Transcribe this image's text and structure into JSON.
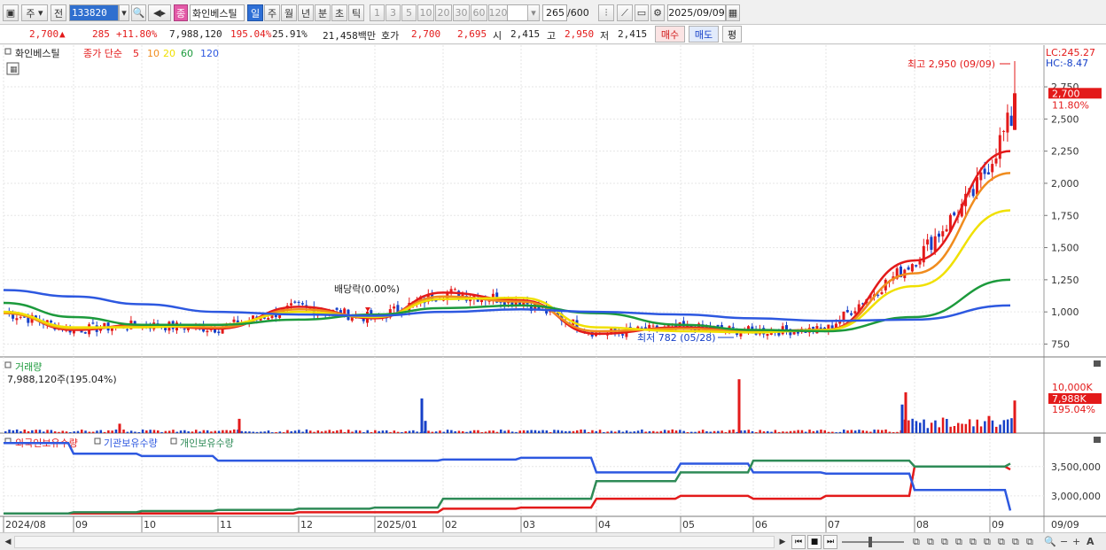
{
  "toolbar": {
    "market_label": "주",
    "prev_label": "전",
    "code": "133820",
    "sort_label": "종",
    "stock_name": "화인베스틸",
    "period_tabs": [
      "일",
      "주",
      "월",
      "년",
      "분",
      "초",
      "틱"
    ],
    "active_period": "일",
    "intervals": [
      "1",
      "3",
      "5",
      "10",
      "20",
      "30",
      "60",
      "120"
    ],
    "count": "265",
    "count_total": "/600",
    "date": "2025/09/09"
  },
  "quote": {
    "price": "2,700",
    "change": "285",
    "change_pct": "+11.80%",
    "volume": "7,988,120",
    "volume_ratio": "195.04%",
    "turnover": "25.91%",
    "amount": "21,458백만",
    "hoga_label": "호가",
    "ask": "2,700",
    "bid": "2,695",
    "open_label": "시",
    "open": "2,415",
    "high_label": "고",
    "high": "2,950",
    "low_label": "저",
    "low": "2,415",
    "buy_label": "매수",
    "sell_label": "매도",
    "eval_label": "평"
  },
  "price_panel": {
    "stock_label": "화인베스틸",
    "ma_title": "종가 단순",
    "ma_periods": [
      "5",
      "10",
      "20",
      "60",
      "120"
    ],
    "lc": "LC:245.27",
    "hc": "HC:-8.47",
    "current_tag": "2,700",
    "current_pct": "11.80%",
    "high_annot": "최고 2,950 (09/09)",
    "low_annot": "최저 782 (05/28)",
    "dividend_annot": "배당락(0.00%)",
    "y_ticks": [
      "750",
      "1,000",
      "1,250",
      "1,500",
      "1,750",
      "2,000",
      "2,250",
      "2,500",
      "2,750"
    ]
  },
  "volume_panel": {
    "title": "거래량",
    "value": "7,988,120주(195.04%)",
    "tag_top": "10,000K",
    "tag_value": "7,988K",
    "tag_pct": "195.04%"
  },
  "holding_panel": {
    "labels": [
      "외국인보유수량",
      "기관보유수량",
      "개인보유수량"
    ],
    "y_ticks": [
      "3,500,000",
      "3,000,000"
    ]
  },
  "x_axis": [
    "2024/08",
    "09",
    "10",
    "11",
    "12",
    "2025/01",
    "02",
    "03",
    "04",
    "05",
    "06",
    "07",
    "08",
    "09",
    "09/09"
  ],
  "colors": {
    "up": "#e31a1a",
    "down": "#1640c8",
    "ma5": "#e31a1a",
    "ma10": "#f08c1e",
    "ma20": "#f0e000",
    "ma60": "#1c9a3c",
    "ma120": "#2d58e0",
    "foreign": "#e31a1a",
    "institution": "#2d58e0",
    "individual": "#2e8b57"
  },
  "chart_data": [
    {
      "type": "line",
      "title": "화인베스틸",
      "description": "Daily price with moving averages",
      "x": [
        "2024/08",
        "09",
        "10",
        "11",
        "12",
        "2025/01",
        "02",
        "03",
        "04",
        "05",
        "06",
        "07",
        "08",
        "09"
      ],
      "series": [
        {
          "name": "5",
          "values": [
            1000,
            860,
            900,
            870,
            1040,
            950,
            1150,
            1090,
            830,
            880,
            850,
            860,
            1400,
            2250
          ]
        },
        {
          "name": "10",
          "values": [
            990,
            870,
            890,
            880,
            1020,
            960,
            1120,
            1080,
            850,
            870,
            850,
            860,
            1300,
            2080
          ]
        },
        {
          "name": "20",
          "values": [
            1000,
            880,
            880,
            900,
            1000,
            960,
            1100,
            1110,
            880,
            850,
            840,
            860,
            1200,
            1790
          ]
        },
        {
          "name": "60",
          "values": [
            1070,
            960,
            900,
            900,
            940,
            980,
            1030,
            1050,
            990,
            900,
            860,
            850,
            960,
            1250
          ]
        },
        {
          "name": "120",
          "values": [
            1170,
            1120,
            1060,
            1000,
            980,
            970,
            1000,
            1020,
            1000,
            980,
            950,
            930,
            940,
            1050
          ]
        }
      ],
      "ylim": [
        650,
        2950
      ],
      "high": 2950,
      "low": 782
    },
    {
      "type": "bar",
      "title": "거래량",
      "categories": [
        "2024/08",
        "09",
        "10",
        "11",
        "12",
        "2025/01",
        "02",
        "03",
        "04",
        "05",
        "06",
        "07",
        "08",
        "09"
      ],
      "values": [
        1500,
        800,
        2500,
        600,
        4000,
        900,
        11000,
        1200,
        600,
        700,
        16000,
        900,
        13500,
        7988
      ],
      "ylabel": "K"
    },
    {
      "type": "line",
      "title": "보유수량",
      "x": [
        "2024/08",
        "09",
        "10",
        "11",
        "12",
        "2025/01",
        "02",
        "03",
        "04",
        "05",
        "06",
        "07",
        "08",
        "09"
      ],
      "series": [
        {
          "name": "외국인보유수량",
          "values": [
            2700000,
            2700000,
            2700000,
            2700000,
            2720000,
            2720000,
            2780000,
            2800000,
            2950000,
            3000000,
            2950000,
            3000000,
            3500000,
            3450000
          ]
        },
        {
          "name": "기관보유수량",
          "values": [
            3900000,
            3720000,
            3680000,
            3600000,
            3600000,
            3600000,
            3620000,
            3650000,
            3400000,
            3550000,
            3400000,
            3380000,
            3100000,
            2750000
          ]
        },
        {
          "name": "개인보유수량",
          "values": [
            2700000,
            2720000,
            2740000,
            2760000,
            2780000,
            2800000,
            2950000,
            2950000,
            3250000,
            3400000,
            3600000,
            3600000,
            3500000,
            3550000
          ]
        }
      ]
    }
  ]
}
